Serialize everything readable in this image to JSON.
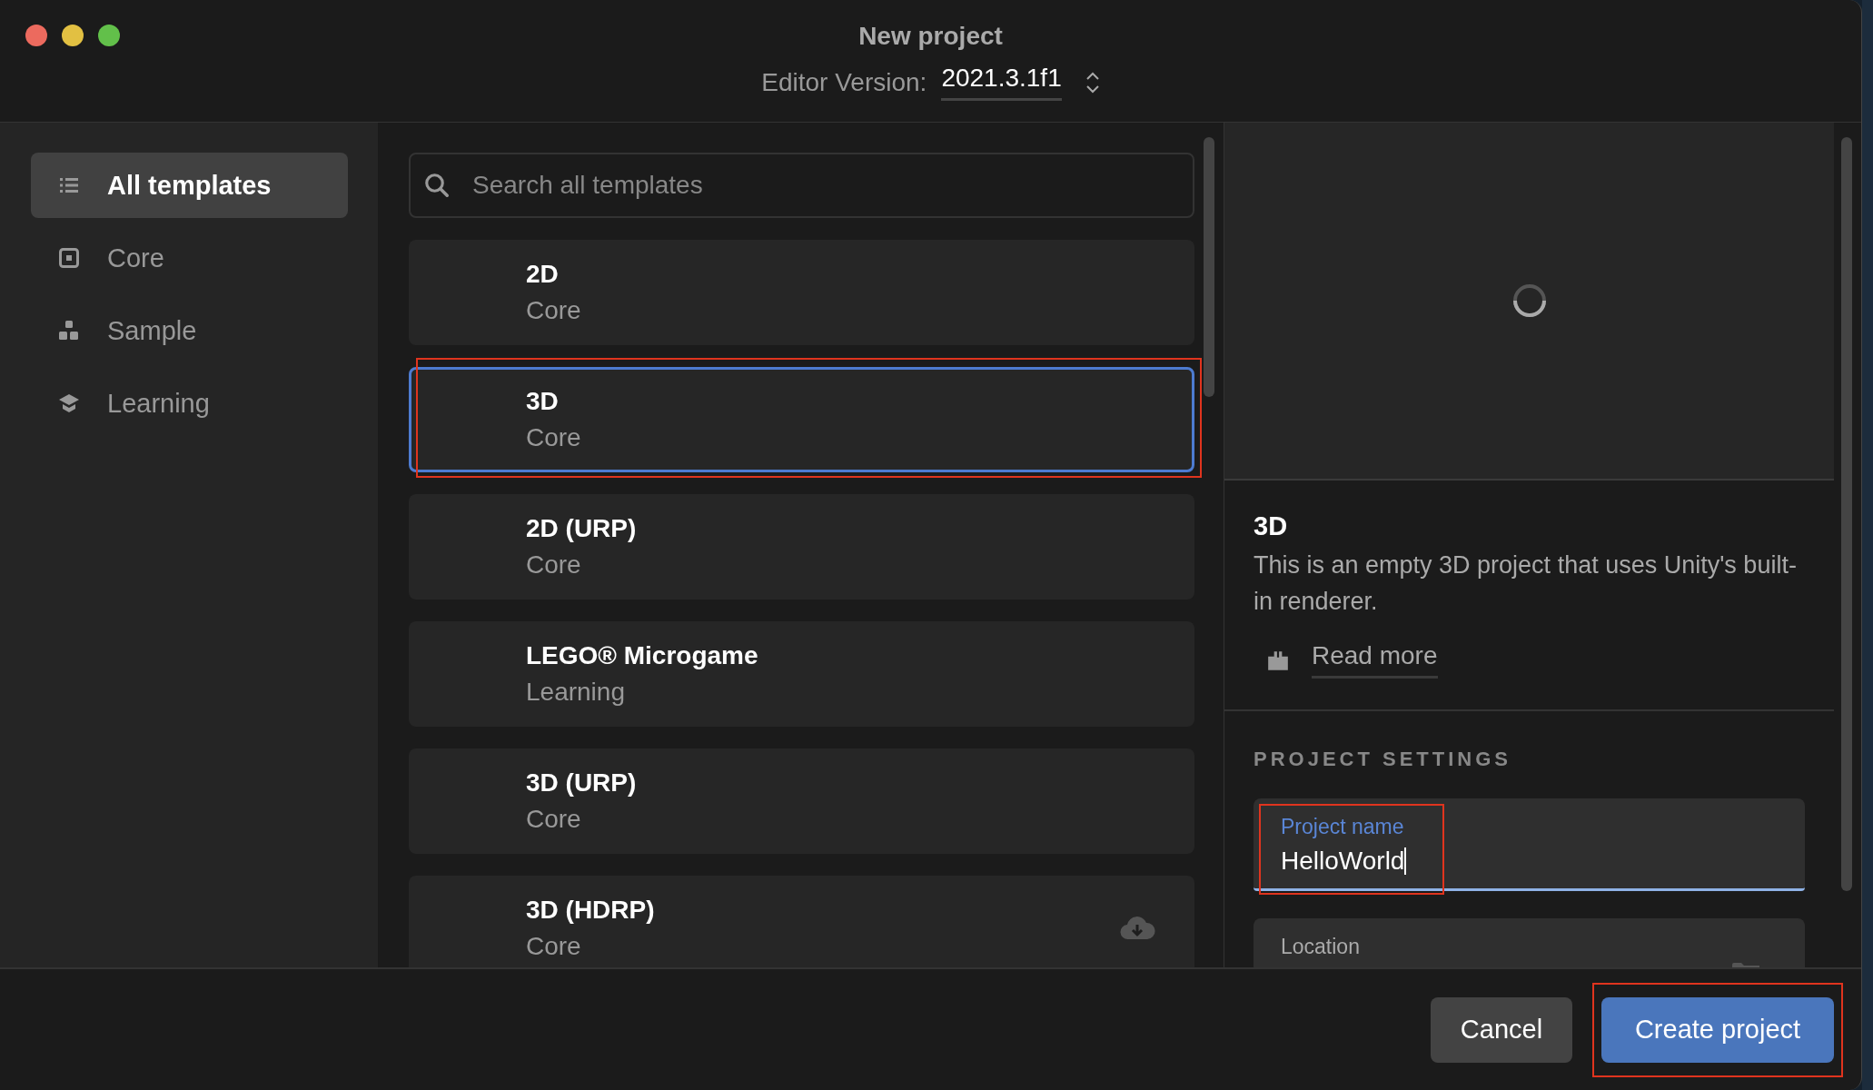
{
  "window": {
    "title": "New project",
    "editor_version_label": "Editor Version:",
    "editor_version": "2021.3.1f1"
  },
  "sidebar": {
    "items": [
      {
        "label": "All templates",
        "selected": true
      },
      {
        "label": "Core",
        "selected": false
      },
      {
        "label": "Sample",
        "selected": false
      },
      {
        "label": "Learning",
        "selected": false
      }
    ]
  },
  "search": {
    "placeholder": "Search all templates"
  },
  "templates": [
    {
      "name": "2D",
      "category": "Core",
      "selected": false,
      "downloadable": false
    },
    {
      "name": "3D",
      "category": "Core",
      "selected": true,
      "downloadable": false
    },
    {
      "name": "2D (URP)",
      "category": "Core",
      "selected": false,
      "downloadable": false
    },
    {
      "name": "LEGO® Microgame",
      "category": "Learning",
      "selected": false,
      "downloadable": false
    },
    {
      "name": "3D (URP)",
      "category": "Core",
      "selected": false,
      "downloadable": false
    },
    {
      "name": "3D (HDRP)",
      "category": "Core",
      "selected": false,
      "downloadable": true
    }
  ],
  "details": {
    "title": "3D",
    "description": "This is an empty 3D project that uses Unity's built-in renderer.",
    "read_more": "Read more"
  },
  "project_settings": {
    "heading": "PROJECT SETTINGS",
    "fields": [
      {
        "label": "Project name",
        "value": "HelloWorld",
        "focused": true
      },
      {
        "label": "Location",
        "focused": false
      }
    ]
  },
  "buttons": [
    {
      "label": "Cancel",
      "kind": "secondary"
    },
    {
      "label": "Create project",
      "kind": "primary"
    }
  ]
}
